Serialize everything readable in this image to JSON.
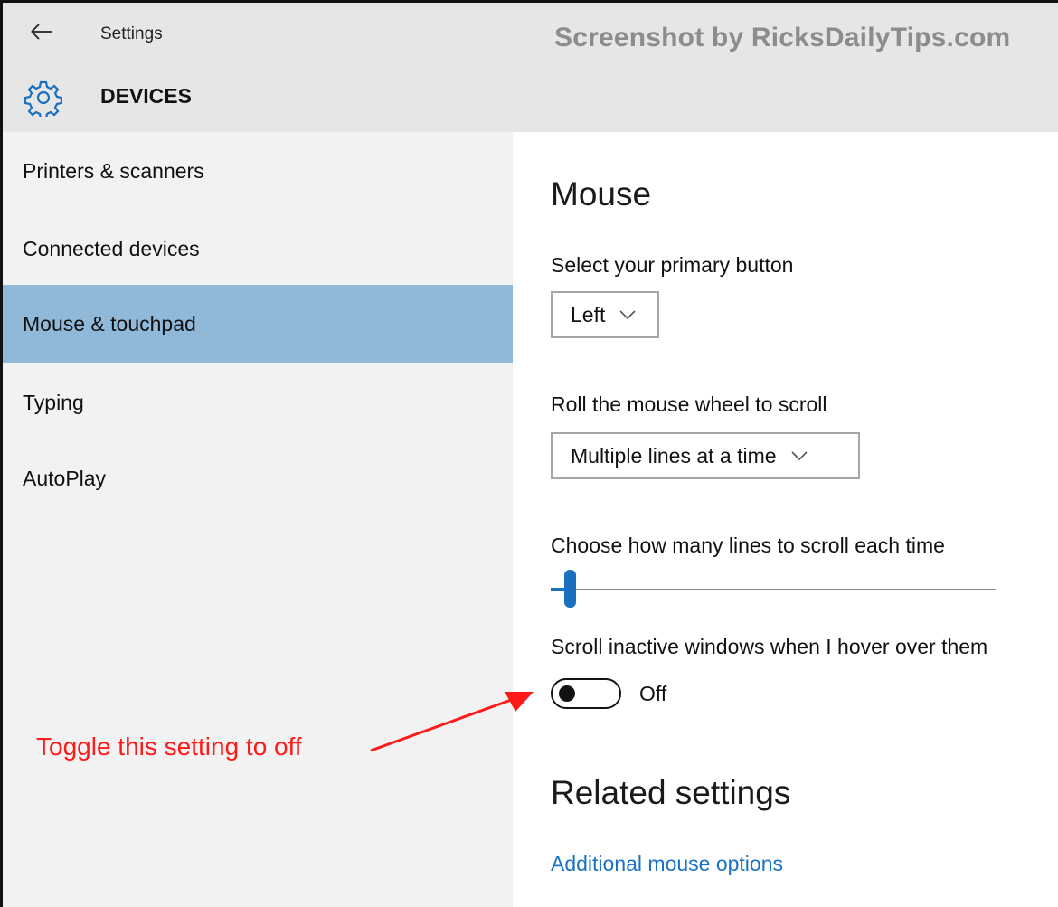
{
  "window": {
    "title": "Settings",
    "back_icon": "arrow-left-icon",
    "watermark": "Screenshot by RicksDailyTips.com"
  },
  "header": {
    "icon": "gear-icon",
    "section": "DEVICES"
  },
  "sidebar": {
    "items": [
      {
        "label": "Printers & scanners",
        "selected": false
      },
      {
        "label": "Connected devices",
        "selected": false
      },
      {
        "label": "Mouse & touchpad",
        "selected": true
      },
      {
        "label": "Typing",
        "selected": false
      },
      {
        "label": "AutoPlay",
        "selected": false
      }
    ]
  },
  "main": {
    "title": "Mouse",
    "primary_button": {
      "label": "Select your primary button",
      "value": "Left"
    },
    "wheel_scroll": {
      "label": "Roll the mouse wheel to scroll",
      "value": "Multiple lines at a time"
    },
    "lines_slider": {
      "label": "Choose how many lines to scroll each time",
      "level_fraction": 0.03
    },
    "inactive_scroll": {
      "label": "Scroll inactive windows when I hover over them",
      "state": "Off"
    },
    "related": {
      "title": "Related settings",
      "link": "Additional mouse options"
    }
  },
  "annotation": {
    "text": "Toggle this setting to off",
    "color": "#ff1a1a"
  },
  "colors": {
    "accent": "#1a6fbf",
    "selected_nav": "#90b8d9",
    "sidebar_bg": "#f2f2f2",
    "header_bg": "#e6e6e6",
    "link": "#1a72c4"
  }
}
